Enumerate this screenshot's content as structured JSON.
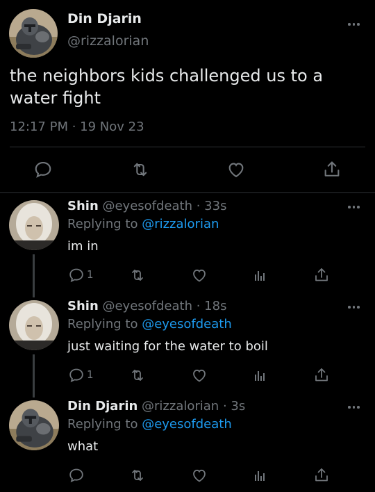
{
  "main_tweet": {
    "name": "Din Djarin",
    "handle": "@rizzalorian",
    "text": "the neighbors kids challenged us to a water fight",
    "timestamp": "12:17 PM · 19 Nov 23",
    "actions": [
      "reply-icon",
      "retweet-icon",
      "like-icon",
      "share-icon"
    ]
  },
  "replies": [
    {
      "name": "Shin",
      "meta": " @eyesofdeath · 33s",
      "replying_prefix": "Replying to ",
      "replying_to": "@rizzalorian",
      "text": "im in",
      "reply_count": "1",
      "avatar": "shin"
    },
    {
      "name": "Shin",
      "meta": " @eyesofdeath · 18s",
      "replying_prefix": "Replying to ",
      "replying_to": "@eyesofdeath",
      "text": "just waiting for the water to boil",
      "reply_count": "1",
      "avatar": "mando"
    },
    {
      "name": "Din Djarin",
      "meta": " @rizzalorian · 3s",
      "replying_prefix": "Replying to ",
      "replying_to": "@eyesofdeath",
      "text": "what",
      "reply_count": "",
      "avatar": "mando"
    }
  ],
  "colors": {
    "background": "#000000",
    "text": "#e7e9ea",
    "muted": "#71767b",
    "link": "#1d9bf0",
    "divider": "#2f3336"
  }
}
